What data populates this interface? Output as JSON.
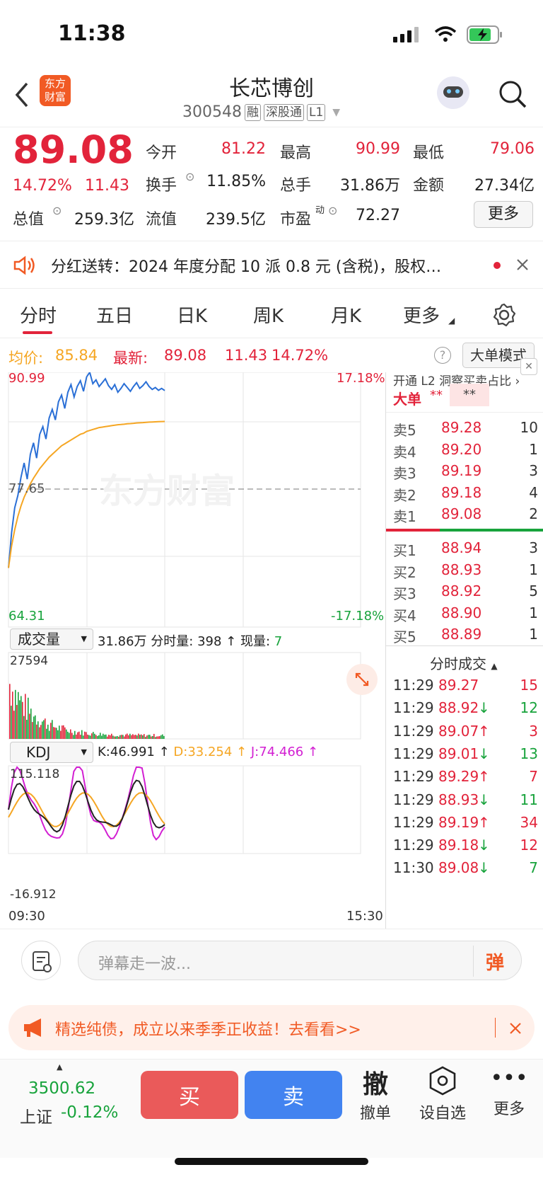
{
  "status": {
    "time": "11:38"
  },
  "header": {
    "logo_line1": "东方",
    "logo_line2": "财富",
    "name": "长芯博创",
    "code": "300548",
    "tags": [
      "融",
      "深股通",
      "L1"
    ]
  },
  "quote": {
    "price": "89.08",
    "pct": "14.72%",
    "chg": "11.43",
    "fields": [
      {
        "label": "今开",
        "value": "81.22",
        "color": "red"
      },
      {
        "label": "最高",
        "value": "90.99",
        "color": "red"
      },
      {
        "label": "最低",
        "value": "79.06",
        "color": "red"
      },
      {
        "label": "换手",
        "value": "11.85%",
        "color": "dark"
      },
      {
        "label": "总手",
        "value": "31.86万",
        "color": "dark"
      },
      {
        "label": "金额",
        "value": "27.34亿",
        "color": "dark"
      },
      {
        "label": "总值",
        "value": "259.3亿",
        "color": "dark"
      },
      {
        "label": "流值",
        "value": "239.5亿",
        "color": "dark"
      },
      {
        "label": "市盈",
        "value": "72.27",
        "color": "dark"
      }
    ],
    "pe_sup": "动",
    "more_button": "更多"
  },
  "notice": {
    "text": "分红送转：2024 年度分配 10 派 0.8 元 (含税)，股权…"
  },
  "tabs": {
    "items": [
      "分时",
      "五日",
      "日K",
      "周K",
      "月K",
      "更多"
    ],
    "active": 0
  },
  "avg": {
    "avg_label": "均价:",
    "avg_value": "85.84",
    "last_label": "最新:",
    "last_value": "89.08",
    "chg": "11.43",
    "pct": "14.72%",
    "mode_button": "大单模式"
  },
  "chart": {
    "ymax": "90.99",
    "ymid": "77.65",
    "ymin": "64.31",
    "pmax": "17.18%",
    "pmin": "-17.18%",
    "watermark": "东方财富",
    "vol_selector": "成交量",
    "vol_total": "31.86万",
    "vol_period_label": "分时量:",
    "vol_period": "398",
    "vol_now_label": "现量:",
    "vol_now": "7",
    "vol_max": "27594",
    "kdj_selector": "KDJ",
    "k": "K:46.991",
    "d": "D:33.254",
    "j": "J:74.466",
    "kdj_max": "115.118",
    "kdj_min": "-16.912",
    "t_start": "09:30",
    "t_end": "15:30"
  },
  "chart_data": {
    "type": "line",
    "ylim": [
      64.31,
      90.99
    ],
    "series": [
      {
        "name": "price",
        "values": [
          70.5,
          74.2,
          76.8,
          78.1,
          80.0,
          81.5,
          79.8,
          82.4,
          83.6,
          82.0,
          84.5,
          85.3,
          84.0,
          86.2,
          87.1,
          86.0,
          87.9,
          88.6,
          87.2,
          88.9,
          89.7,
          88.4,
          89.5,
          90.1,
          89.0,
          90.5,
          90.99,
          89.8,
          90.2,
          89.5,
          89.9,
          90.3,
          89.6,
          89.2,
          89.7,
          88.9,
          89.3,
          89.8,
          89.4,
          89.0,
          89.5,
          89.9,
          89.3,
          89.6,
          90.0,
          89.5,
          89.2,
          89.4,
          89.1,
          89.3,
          89.08
        ]
      },
      {
        "name": "avg",
        "values": [
          70.5,
          72.8,
          74.5,
          75.9,
          77.0,
          77.9,
          78.6,
          79.3,
          79.9,
          80.4,
          80.9,
          81.3,
          81.7,
          82.1,
          82.4,
          82.7,
          83.0,
          83.3,
          83.5,
          83.7,
          83.9,
          84.1,
          84.3,
          84.5,
          84.6,
          84.8,
          84.9,
          85.0,
          85.1,
          85.2,
          85.25,
          85.3,
          85.35,
          85.4,
          85.45,
          85.5,
          85.52,
          85.55,
          85.6,
          85.62,
          85.65,
          85.68,
          85.7,
          85.72,
          85.75,
          85.77,
          85.79,
          85.8,
          85.82,
          85.83,
          85.84
        ]
      }
    ]
  },
  "orderbook": {
    "promo": "开通 L2 洞察买卖占比",
    "big_label": "大单",
    "big_v1": "**",
    "big_v2": "**",
    "asks": [
      {
        "l": "卖5",
        "p": "89.28",
        "v": "10"
      },
      {
        "l": "卖4",
        "p": "89.20",
        "v": "1"
      },
      {
        "l": "卖3",
        "p": "89.19",
        "v": "3"
      },
      {
        "l": "卖2",
        "p": "89.18",
        "v": "4"
      },
      {
        "l": "卖1",
        "p": "89.08",
        "v": "2"
      }
    ],
    "bids": [
      {
        "l": "买1",
        "p": "88.94",
        "v": "3"
      },
      {
        "l": "买2",
        "p": "88.93",
        "v": "1"
      },
      {
        "l": "买3",
        "p": "88.92",
        "v": "5"
      },
      {
        "l": "买4",
        "p": "88.90",
        "v": "1"
      },
      {
        "l": "买5",
        "p": "88.89",
        "v": "1"
      }
    ],
    "ticks_title": "分时成交",
    "ticks": [
      {
        "t": "11:29",
        "p": "89.27",
        "a": "",
        "v": "15",
        "vc": "red"
      },
      {
        "t": "11:29",
        "p": "88.92",
        "a": "↓",
        "v": "12",
        "vc": "green"
      },
      {
        "t": "11:29",
        "p": "89.07",
        "a": "↑",
        "v": "3",
        "vc": "red"
      },
      {
        "t": "11:29",
        "p": "89.01",
        "a": "↓",
        "v": "13",
        "vc": "green"
      },
      {
        "t": "11:29",
        "p": "89.29",
        "a": "↑",
        "v": "7",
        "vc": "red"
      },
      {
        "t": "11:29",
        "p": "88.93",
        "a": "↓",
        "v": "11",
        "vc": "green"
      },
      {
        "t": "11:29",
        "p": "89.19",
        "a": "↑",
        "v": "34",
        "vc": "red"
      },
      {
        "t": "11:29",
        "p": "89.18",
        "a": "↓",
        "v": "12",
        "vc": "red"
      },
      {
        "t": "11:30",
        "p": "89.08",
        "a": "↓",
        "v": "7",
        "vc": "green"
      }
    ]
  },
  "comment": {
    "placeholder": "弹幕走一波...",
    "danmu": "弹"
  },
  "ad": {
    "text": "精选纯债，成立以来季季正收益！去看看>>"
  },
  "bottom": {
    "index_value": "3500.62",
    "index_name": "上证",
    "index_pct": "-0.12%",
    "buy": "买",
    "sell": "卖",
    "cancel_glyph": "撤",
    "cancel": "撤单",
    "add": "设自选",
    "more": "更多"
  }
}
